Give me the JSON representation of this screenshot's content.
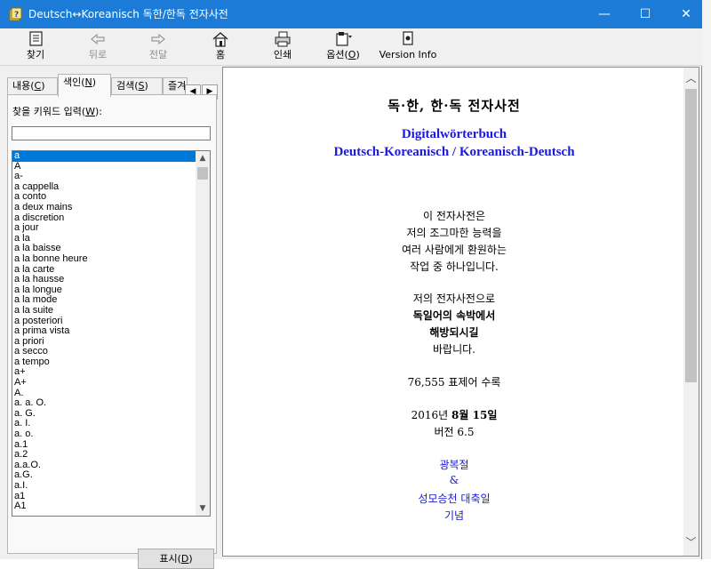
{
  "window": {
    "title": "Deutsch↔Koreanisch 독한/한독 전자사전",
    "minimize": "—",
    "maximize": "☐",
    "close": "✕"
  },
  "toolbar": {
    "find": "찾기",
    "back": "뒤로",
    "forward": "전달",
    "home": "홈",
    "print": "인쇄",
    "options_prefix": "옵션(",
    "options_key": "O",
    "options_suffix": ")",
    "version_info": "Version Info"
  },
  "tabs": {
    "contents_prefix": "내용(",
    "contents_key": "C",
    "contents_suffix": ")",
    "index_prefix": "색인(",
    "index_key": "N",
    "index_suffix": ")",
    "search_prefix": "검색(",
    "search_key": "S",
    "search_suffix": ")",
    "favorites": "즐겨",
    "scroll_left": "◀",
    "scroll_right": "▶"
  },
  "index": {
    "label_prefix": "찾을 키워드 입력(",
    "label_key": "W",
    "label_suffix": "):",
    "input_value": "",
    "items": [
      "a",
      "A",
      "a-",
      "a cappella",
      "a conto",
      "a deux mains",
      "a discretion",
      "a jour",
      "a la",
      "a la baisse",
      "a la bonne heure",
      "a la carte",
      "a la hausse",
      "a la longue",
      "a la mode",
      "a la suite",
      "a posteriori",
      "a prima vista",
      "a priori",
      "a secco",
      "a tempo",
      "a+",
      "A+",
      "A.",
      "a. a. O.",
      "a. G.",
      "a. I.",
      "a. o.",
      "a.1",
      "a.2",
      "a.a.O.",
      "a.G.",
      "a.I.",
      "a1",
      "A1"
    ],
    "selected_index": 0,
    "show_prefix": "표시(",
    "show_key": "D",
    "show_suffix": ")"
  },
  "content": {
    "title": "독·한, 한·독 전자사전",
    "de_title": "Digitalwörterbuch",
    "de_subtitle": "Deutsch-Koreanisch / Koreanisch-Deutsch",
    "p1": [
      "이 전자사전은",
      "저의 조그마한 능력을",
      "여러 사람에게 환원하는",
      "작업 중 하나입니다."
    ],
    "p2": [
      "저의 전자사전으로",
      "독일어의 속박에서",
      "해방되시길",
      "바랍니다."
    ],
    "entries": "76,555 표제어 수록",
    "date_year": "2016년 ",
    "date_month": "8월 15일",
    "version": "버전 6.5",
    "dedication": [
      "광복절",
      "&",
      "성모승천 대축일",
      "기념"
    ]
  },
  "colors": {
    "titlebar": "#1b7bd6",
    "accent_blue": "#1a1ad8",
    "selection": "#0078d7"
  }
}
